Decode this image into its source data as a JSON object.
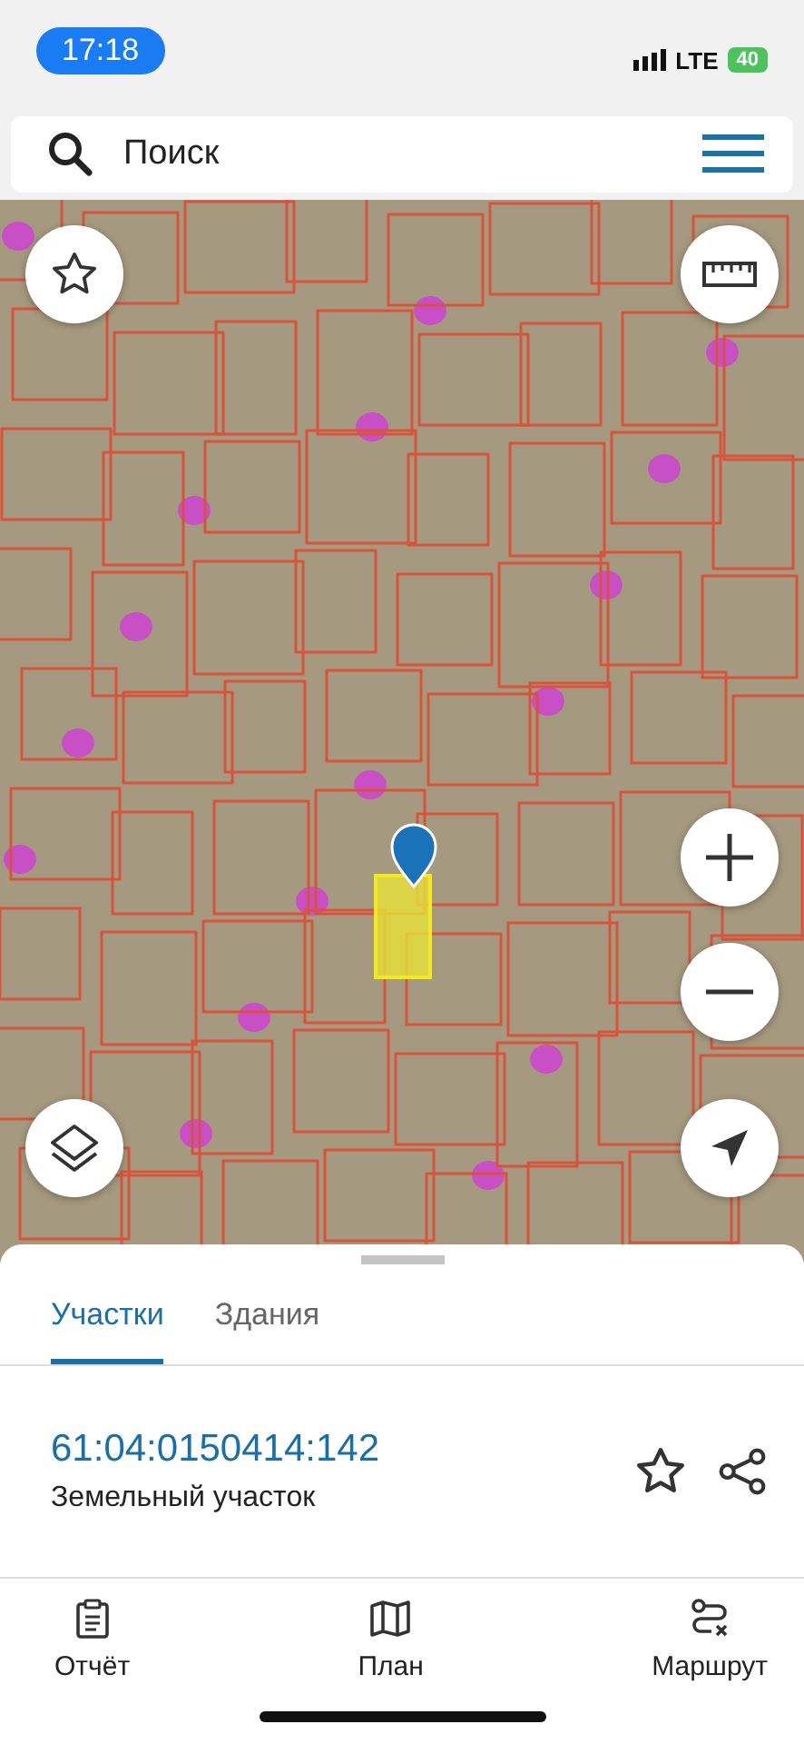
{
  "status_bar": {
    "time": "17:18",
    "network": "LTE",
    "battery": "40"
  },
  "search": {
    "placeholder": "Поиск"
  },
  "tabs": [
    {
      "label": "Участки",
      "selected": true
    },
    {
      "label": "Здания",
      "selected": false
    }
  ],
  "parcel": {
    "number": "61:04:0150414:142",
    "type": "Земельный участок"
  },
  "nav": [
    {
      "label": "Отчёт",
      "kind": "report"
    },
    {
      "label": "План",
      "kind": "plan"
    },
    {
      "label": "Маршрут",
      "kind": "route"
    }
  ]
}
